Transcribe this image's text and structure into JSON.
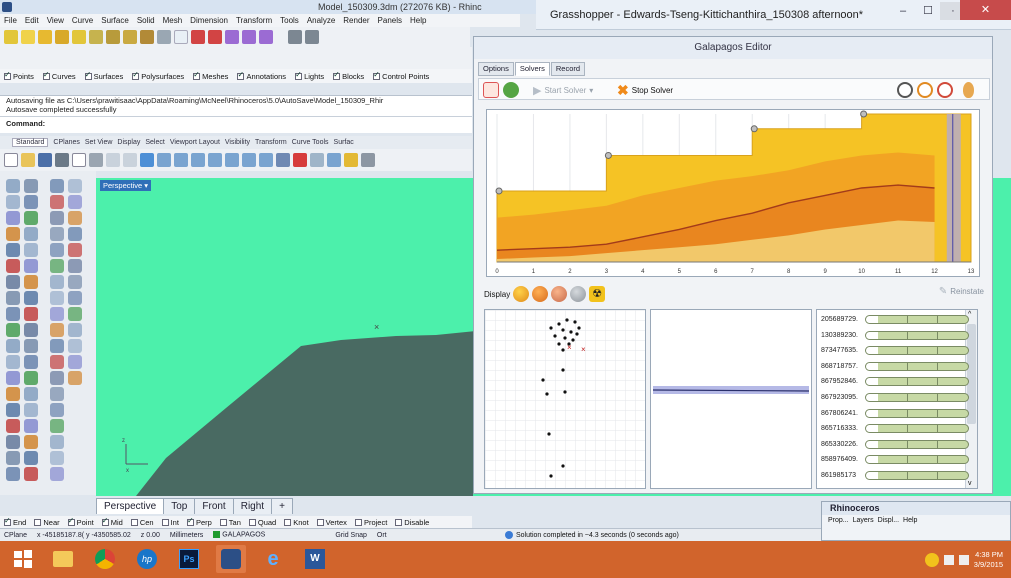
{
  "rhino": {
    "title": "Model_150309.3dm (272076 KB) - Rhinc",
    "menu": [
      "File",
      "Edit",
      "View",
      "Curve",
      "Surface",
      "Solid",
      "Mesh",
      "Dimension",
      "Transform",
      "Tools",
      "Analyze",
      "Render",
      "Panels",
      "Help"
    ],
    "filters": [
      {
        "label": "Points",
        "checked": true
      },
      {
        "label": "Curves",
        "checked": true
      },
      {
        "label": "Surfaces",
        "checked": true
      },
      {
        "label": "Polysurfaces",
        "checked": true
      },
      {
        "label": "Meshes",
        "checked": true
      },
      {
        "label": "Annotations",
        "checked": true
      },
      {
        "label": "Lights",
        "checked": true
      },
      {
        "label": "Blocks",
        "checked": true
      },
      {
        "label": "Control Points",
        "checked": true
      }
    ],
    "command_history": [
      "Autosaving file as C:\\Users\\prawitisaac\\AppData\\Roaming\\McNeel\\Rhinoceros\\5.0\\AutoSave\\Model_150309_Rhir",
      "Autosave completed successfully"
    ],
    "command_label": "Command:",
    "toolbar_tabs": [
      "Standard",
      "CPlanes",
      "Set View",
      "Display",
      "Select",
      "Viewport Layout",
      "Visibility",
      "Transform",
      "Curve Tools",
      "Surfac"
    ],
    "viewport_label": "Perspective",
    "viewport_tabs": [
      "Perspective",
      "Top",
      "Front",
      "Right"
    ],
    "osnaps": [
      {
        "label": "End",
        "checked": true
      },
      {
        "label": "Near",
        "checked": false
      },
      {
        "label": "Point",
        "checked": true
      },
      {
        "label": "Mid",
        "checked": true
      },
      {
        "label": "Cen",
        "checked": false
      },
      {
        "label": "Int",
        "checked": false
      },
      {
        "label": "Perp",
        "checked": true
      },
      {
        "label": "Tan",
        "checked": false
      },
      {
        "label": "Quad",
        "checked": false
      },
      {
        "label": "Knot",
        "checked": false
      },
      {
        "label": "Vertex",
        "checked": false
      },
      {
        "label": "Project",
        "checked": false
      },
      {
        "label": "Disable",
        "checked": false
      }
    ],
    "status": {
      "cplane": "CPlane",
      "coords": "x -45185187.8( y -4350585.02",
      "z": "z 0.00",
      "units": "Millimeters",
      "layer": "GALAPAGOS",
      "grid_snap": "Grid Snap",
      "ortho": "Ort"
    }
  },
  "grasshopper": {
    "title": "Grasshopper - Edwards-Tseng-Kittichanthira_150308 afternoon*",
    "status": "Solution completed in ~4.3 seconds (0 seconds ago)"
  },
  "galapagos": {
    "title": "Galapagos Editor",
    "tabs": [
      "Options",
      "Solvers",
      "Record"
    ],
    "active_tab": "Solvers",
    "start_label": "Start Solver",
    "stop_label": "Stop Solver",
    "display_label": "Display",
    "reinstate_label": "Reinstate",
    "genome_values": [
      "205689729.",
      "130389230.",
      "873477635.",
      "868718757.",
      "867952846.",
      "867923095.",
      "867806241.",
      "865716333.",
      "865330226.",
      "858976409.",
      "861985173"
    ]
  },
  "chart_data": {
    "type": "area",
    "x_ticks": [
      0,
      1,
      2,
      3,
      4,
      5,
      6,
      7,
      8,
      9,
      10,
      11,
      12,
      13
    ],
    "xlim": [
      0,
      13
    ],
    "ylim": [
      0,
      1
    ],
    "current_generation": 12.5,
    "series": [
      {
        "values": [
          0.48,
          0.48,
          0.48,
          0.72,
          0.72,
          0.72,
          0.72,
          0.9,
          0.9,
          0.9,
          1.0,
          1.0,
          1.0
        ]
      },
      {
        "values": [
          0.3,
          0.32,
          0.35,
          0.38,
          0.45,
          0.5,
          0.55,
          0.58,
          0.62,
          0.68,
          0.72,
          0.74,
          0.72
        ]
      },
      {
        "values": [
          0.08,
          0.09,
          0.1,
          0.12,
          0.17,
          0.22,
          0.28,
          0.33,
          0.4,
          0.45,
          0.5,
          0.52,
          0.5
        ]
      },
      {
        "values": [
          0.02,
          0.03,
          0.04,
          0.06,
          0.08,
          0.1,
          0.12,
          0.15,
          0.18,
          0.22,
          0.25,
          0.28,
          0.27
        ]
      }
    ],
    "markers": [
      0,
      3,
      7,
      10
    ]
  },
  "taskbar": {
    "apps": [
      "start",
      "explorer",
      "chrome",
      "hp",
      "photoshop",
      "rhino",
      "ie",
      "word"
    ],
    "time": "4:38 PM",
    "date": "3/9/2015"
  },
  "rhino_panel": {
    "title": "Rhinoceros",
    "tabs": [
      "Prop...",
      "Layers",
      "Displ...",
      "Help"
    ]
  },
  "colors": {
    "viewport_bg": "#4cf0ab",
    "terrain": "#496a62",
    "taskbar": "#d1642c",
    "chart_best": "#f5c325",
    "chart_mid": "#f2a423",
    "chart_low": "#e9861f",
    "chart_line": "#a33b1a"
  }
}
